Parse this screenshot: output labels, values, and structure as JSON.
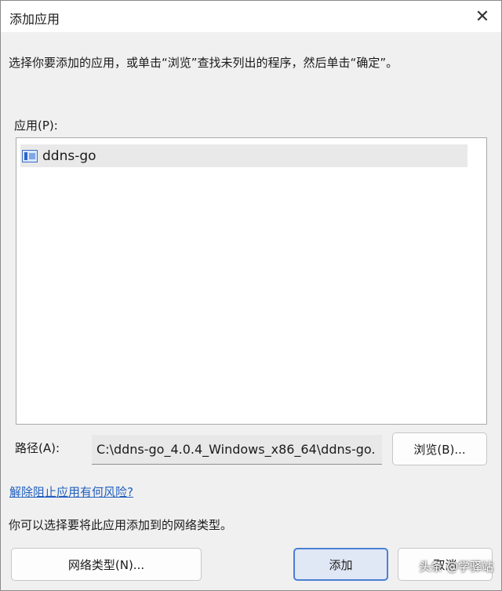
{
  "window": {
    "title": "添加应用",
    "close_glyph": "✕"
  },
  "instruction": "选择你要添加的应用，或单击“浏览”查找未列出的程序，然后单击“确定”。",
  "apps": {
    "label": "应用(P):",
    "items": [
      {
        "label": "ddns-go",
        "icon": "app-window-icon"
      }
    ]
  },
  "path": {
    "label": "路径(A):",
    "value": "C:\\ddns-go_4.0.4_Windows_x86_64\\ddns-go.",
    "browse_label": "浏览(B)..."
  },
  "risk_link": "解除阻止应用有何风险?",
  "network_text": "你可以选择要将此应用添加到的网络类型。",
  "buttons": {
    "network_types": "网络类型(N)...",
    "add": "添加",
    "cancel": "取消"
  },
  "watermark": "头条 @学驿站"
}
